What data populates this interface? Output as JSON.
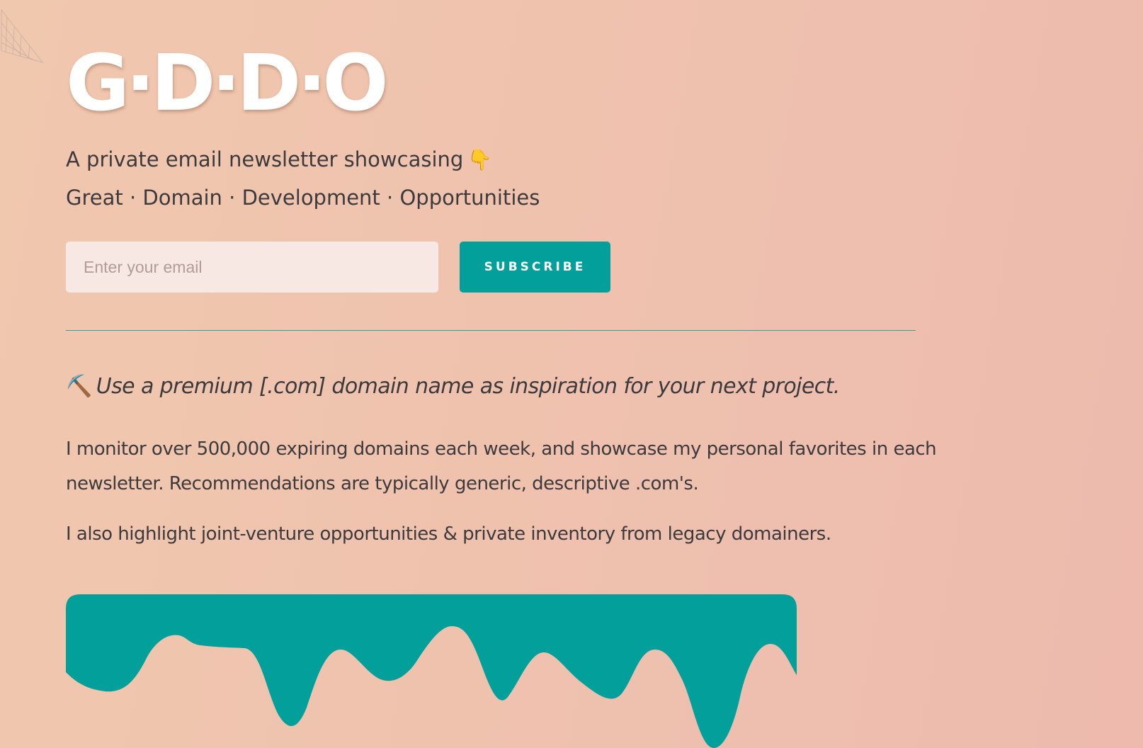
{
  "brand": {
    "logo_text": "G·D·D·O"
  },
  "hero": {
    "tagline_line1": "A private email newsletter showcasing",
    "pointing_emoji": "👇",
    "tagline_line2": "Great · Domain · Development · Opportunities"
  },
  "signup": {
    "email_placeholder": "Enter your email",
    "email_value": "",
    "subscribe_label": "SUBSCRIBE"
  },
  "content": {
    "pick_emoji": "⛏️",
    "pitch": "Use a premium [.com] domain name as inspiration for your next project.",
    "paragraph_1": "I monitor over 500,000 expiring domains each week, and showcase my personal favorites in each newsletter. Recommendations are typically generic, descriptive .com's.",
    "paragraph_2": "I also highlight joint-venture opportunities & private inventory from legacy domainers."
  },
  "colors": {
    "accent": "#03a09b",
    "background_start": "#f0c8ae",
    "background_end": "#edbaad",
    "text": "#3d3a3d",
    "input_background": "#f8e8e4"
  },
  "icons": {
    "corner_mark": "wireframe-pyramid-icon",
    "pointing": "pointing-down-hand-icon",
    "pick": "pickaxe-icon"
  }
}
